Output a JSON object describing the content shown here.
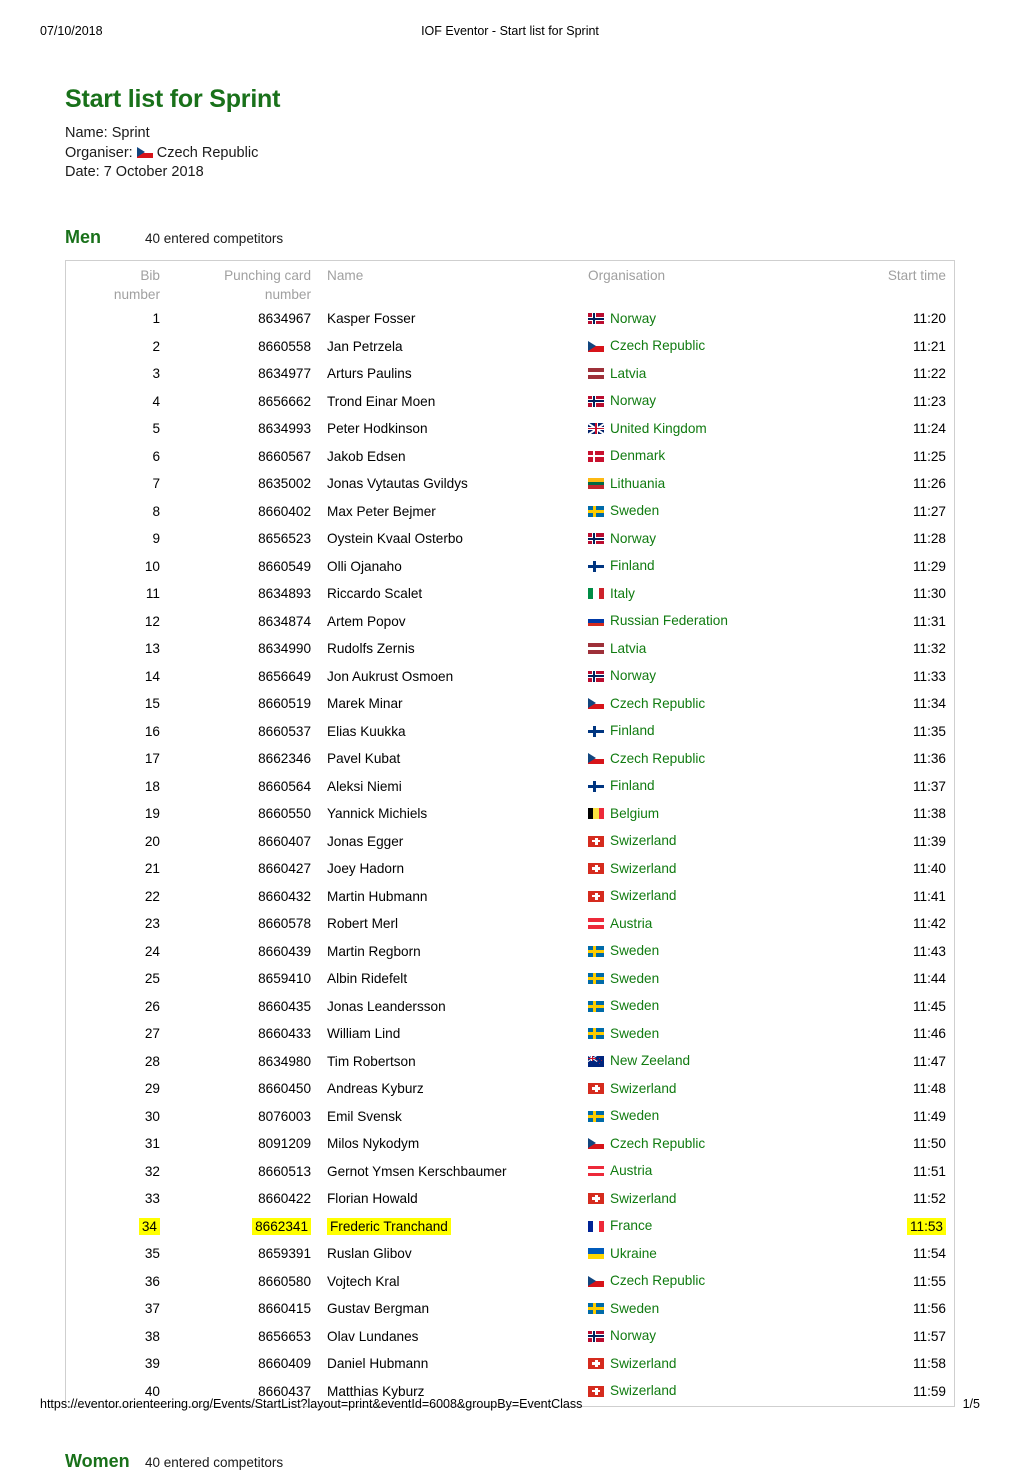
{
  "print_header": {
    "date": "07/10/2018",
    "title": "IOF Eventor - Start list for Sprint"
  },
  "print_footer": {
    "url": "https://eventor.orienteering.org/Events/StartList?layout=print&eventId=6008&groupBy=EventClass",
    "page": "1/5"
  },
  "document": {
    "title": "Start list for Sprint",
    "title_color": "#19711a",
    "meta": {
      "name_label": "Name:",
      "name_value": "Sprint",
      "organiser_label": "Organiser:",
      "organiser_value": "Czech Republic",
      "organiser_flag": "flag-czech-republic-icon",
      "date_label": "Date:",
      "date_value": "7 October 2018"
    }
  },
  "table_headers": {
    "bib": "Bib number",
    "card": "Punching card number",
    "name": "Name",
    "organisation": "Organisation",
    "start_time": "Start time",
    "bib_line1": "Bib",
    "bib_line2": "number",
    "card_line1": "Punching card",
    "card_line2": "number"
  },
  "highlight_color": "#ffff00",
  "organisation_color": "#107b10",
  "classes": [
    {
      "name": "Men",
      "count": "40 entered competitors",
      "rows": [
        {
          "bib": "1",
          "card": "8634967",
          "name": "Kasper Fosser",
          "org": "Norway",
          "flag": "nor",
          "time": "11:20",
          "highlight": false
        },
        {
          "bib": "2",
          "card": "8660558",
          "name": "Jan Petrzela",
          "org": "Czech Republic",
          "flag": "cze",
          "time": "11:21",
          "highlight": false
        },
        {
          "bib": "3",
          "card": "8634977",
          "name": "Arturs Paulins",
          "org": "Latvia",
          "flag": "lva",
          "time": "11:22",
          "highlight": false
        },
        {
          "bib": "4",
          "card": "8656662",
          "name": "Trond Einar Moen",
          "org": "Norway",
          "flag": "nor",
          "time": "11:23",
          "highlight": false
        },
        {
          "bib": "5",
          "card": "8634993",
          "name": "Peter Hodkinson",
          "org": "United Kingdom",
          "flag": "gbr",
          "time": "11:24",
          "highlight": false
        },
        {
          "bib": "6",
          "card": "8660567",
          "name": "Jakob Edsen",
          "org": "Denmark",
          "flag": "dnk",
          "time": "11:25",
          "highlight": false
        },
        {
          "bib": "7",
          "card": "8635002",
          "name": "Jonas Vytautas Gvildys",
          "org": "Lithuania",
          "flag": "ltu",
          "time": "11:26",
          "highlight": false
        },
        {
          "bib": "8",
          "card": "8660402",
          "name": "Max Peter Bejmer",
          "org": "Sweden",
          "flag": "swe",
          "time": "11:27",
          "highlight": false
        },
        {
          "bib": "9",
          "card": "8656523",
          "name": "Oystein Kvaal Osterbo",
          "org": "Norway",
          "flag": "nor",
          "time": "11:28",
          "highlight": false
        },
        {
          "bib": "10",
          "card": "8660549",
          "name": "Olli Ojanaho",
          "org": "Finland",
          "flag": "fin",
          "time": "11:29",
          "highlight": false
        },
        {
          "bib": "11",
          "card": "8634893",
          "name": "Riccardo Scalet",
          "org": "Italy",
          "flag": "ita",
          "time": "11:30",
          "highlight": false
        },
        {
          "bib": "12",
          "card": "8634874",
          "name": "Artem Popov",
          "org": "Russian Federation",
          "flag": "rus",
          "time": "11:31",
          "highlight": false
        },
        {
          "bib": "13",
          "card": "8634990",
          "name": "Rudolfs Zernis",
          "org": "Latvia",
          "flag": "lva",
          "time": "11:32",
          "highlight": false
        },
        {
          "bib": "14",
          "card": "8656649",
          "name": "Jon Aukrust Osmoen",
          "org": "Norway",
          "flag": "nor",
          "time": "11:33",
          "highlight": false
        },
        {
          "bib": "15",
          "card": "8660519",
          "name": "Marek Minar",
          "org": "Czech Republic",
          "flag": "cze",
          "time": "11:34",
          "highlight": false
        },
        {
          "bib": "16",
          "card": "8660537",
          "name": "Elias Kuukka",
          "org": "Finland",
          "flag": "fin",
          "time": "11:35",
          "highlight": false
        },
        {
          "bib": "17",
          "card": "8662346",
          "name": "Pavel Kubat",
          "org": "Czech Republic",
          "flag": "cze",
          "time": "11:36",
          "highlight": false
        },
        {
          "bib": "18",
          "card": "8660564",
          "name": "Aleksi Niemi",
          "org": "Finland",
          "flag": "fin",
          "time": "11:37",
          "highlight": false
        },
        {
          "bib": "19",
          "card": "8660550",
          "name": "Yannick Michiels",
          "org": "Belgium",
          "flag": "bel",
          "time": "11:38",
          "highlight": false
        },
        {
          "bib": "20",
          "card": "8660407",
          "name": "Jonas Egger",
          "org": "Swizerland",
          "flag": "che",
          "time": "11:39",
          "highlight": false
        },
        {
          "bib": "21",
          "card": "8660427",
          "name": "Joey Hadorn",
          "org": "Swizerland",
          "flag": "che",
          "time": "11:40",
          "highlight": false
        },
        {
          "bib": "22",
          "card": "8660432",
          "name": "Martin Hubmann",
          "org": "Swizerland",
          "flag": "che",
          "time": "11:41",
          "highlight": false
        },
        {
          "bib": "23",
          "card": "8660578",
          "name": "Robert Merl",
          "org": "Austria",
          "flag": "aut",
          "time": "11:42",
          "highlight": false
        },
        {
          "bib": "24",
          "card": "8660439",
          "name": "Martin Regborn",
          "org": "Sweden",
          "flag": "swe",
          "time": "11:43",
          "highlight": false
        },
        {
          "bib": "25",
          "card": "8659410",
          "name": "Albin Ridefelt",
          "org": "Sweden",
          "flag": "swe",
          "time": "11:44",
          "highlight": false
        },
        {
          "bib": "26",
          "card": "8660435",
          "name": "Jonas Leandersson",
          "org": "Sweden",
          "flag": "swe",
          "time": "11:45",
          "highlight": false
        },
        {
          "bib": "27",
          "card": "8660433",
          "name": "William Lind",
          "org": "Sweden",
          "flag": "swe",
          "time": "11:46",
          "highlight": false
        },
        {
          "bib": "28",
          "card": "8634980",
          "name": "Tim Robertson",
          "org": "New Zeeland",
          "flag": "nzl",
          "time": "11:47",
          "highlight": false
        },
        {
          "bib": "29",
          "card": "8660450",
          "name": "Andreas Kyburz",
          "org": "Swizerland",
          "flag": "che",
          "time": "11:48",
          "highlight": false
        },
        {
          "bib": "30",
          "card": "8076003",
          "name": "Emil Svensk",
          "org": "Sweden",
          "flag": "swe",
          "time": "11:49",
          "highlight": false
        },
        {
          "bib": "31",
          "card": "8091209",
          "name": "Milos Nykodym",
          "org": "Czech Republic",
          "flag": "cze",
          "time": "11:50",
          "highlight": false
        },
        {
          "bib": "32",
          "card": "8660513",
          "name": "Gernot Ymsen Kerschbaumer",
          "org": "Austria",
          "flag": "aut",
          "time": "11:51",
          "highlight": false
        },
        {
          "bib": "33",
          "card": "8660422",
          "name": "Florian Howald",
          "org": "Swizerland",
          "flag": "che",
          "time": "11:52",
          "highlight": false
        },
        {
          "bib": "34",
          "card": "8662341",
          "name": "Frederic Tranchand",
          "org": "France",
          "flag": "fra",
          "time": "11:53",
          "highlight": true
        },
        {
          "bib": "35",
          "card": "8659391",
          "name": "Ruslan Glibov",
          "org": "Ukraine",
          "flag": "ukr",
          "time": "11:54",
          "highlight": false
        },
        {
          "bib": "36",
          "card": "8660580",
          "name": "Vojtech Kral",
          "org": "Czech Republic",
          "flag": "cze",
          "time": "11:55",
          "highlight": false
        },
        {
          "bib": "37",
          "card": "8660415",
          "name": "Gustav Bergman",
          "org": "Sweden",
          "flag": "swe",
          "time": "11:56",
          "highlight": false
        },
        {
          "bib": "38",
          "card": "8656653",
          "name": "Olav Lundanes",
          "org": "Norway",
          "flag": "nor",
          "time": "11:57",
          "highlight": false
        },
        {
          "bib": "39",
          "card": "8660409",
          "name": "Daniel Hubmann",
          "org": "Swizerland",
          "flag": "che",
          "time": "11:58",
          "highlight": false
        },
        {
          "bib": "40",
          "card": "8660437",
          "name": "Matthias Kyburz",
          "org": "Swizerland",
          "flag": "che",
          "time": "11:59",
          "highlight": false
        }
      ]
    },
    {
      "name": "Women",
      "count": "40 entered competitors",
      "rows": []
    }
  ]
}
